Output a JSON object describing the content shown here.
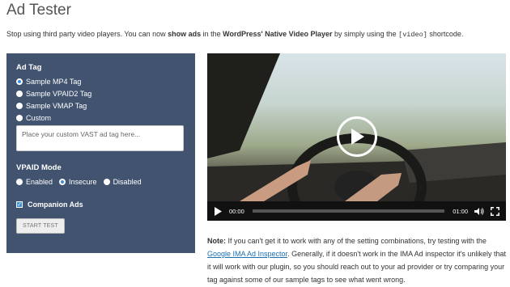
{
  "page": {
    "title": "Ad Tester",
    "desc_pre": "Stop using third party video players. You can now ",
    "desc_bold1": "show ads",
    "desc_mid": " in the ",
    "desc_bold2": "WordPress' Native Video Player",
    "desc_post": " by simply using the ",
    "desc_code": "[video]",
    "desc_end": " shortcode."
  },
  "panel": {
    "ad_tag_heading": "Ad Tag",
    "ad_tag_options": [
      "Sample MP4 Tag",
      "Sample VPAID2 Tag",
      "Sample VMAP Tag",
      "Custom"
    ],
    "ad_tag_selected": 0,
    "custom_placeholder": "Place your custom VAST ad tag here...",
    "vpaid_heading": "VPAID Mode",
    "vpaid_options": [
      "Enabled",
      "Insecure",
      "Disabled"
    ],
    "vpaid_selected": 1,
    "companion_label": "Companion Ads",
    "companion_checked": true,
    "start_button": "START TEST"
  },
  "player": {
    "current_time": "00:00",
    "duration": "01:00",
    "progress": 0
  },
  "note": {
    "label": "Note:",
    "text1": " If you can't get it to work with any of the setting combinations, try testing with the ",
    "link": "Google IMA Ad Inspector",
    "text2": ". Generally, if it doesn't work in the IMA Ad inspector it's unlikely that it will work with our plugin, so you should reach out to your ad provider or try comparing your tag against some of our sample tags to see what went wrong."
  }
}
